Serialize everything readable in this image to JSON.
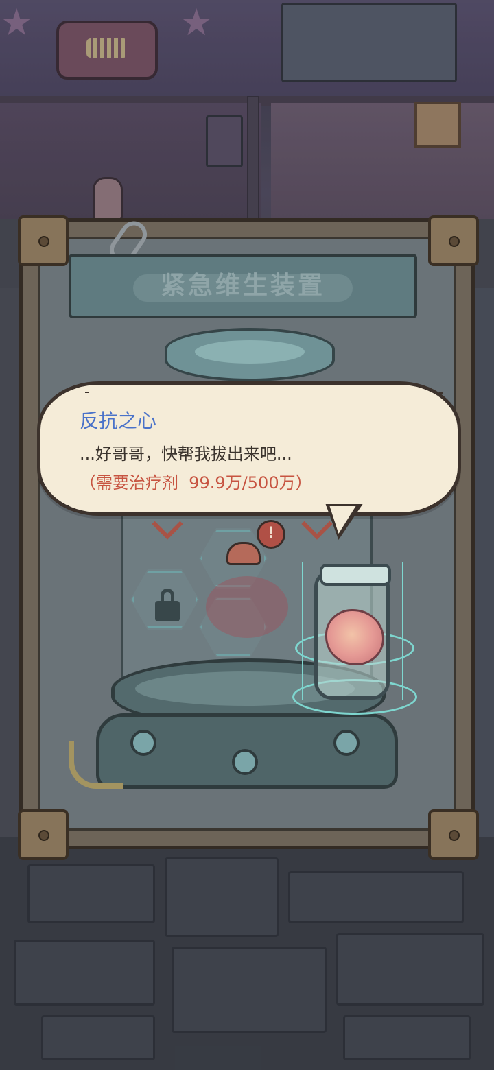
{
  "panel": {
    "title": "紧急维生装置"
  },
  "dialog": {
    "speaker": "反抗之心",
    "line": "...好哥哥，快帮我拔出来吧...",
    "requirement": "（需要治疗剂  99.9万/500万）"
  },
  "machine": {
    "alert_symbol": "!"
  },
  "colors": {
    "speaker": "#4a72c9",
    "requirement": "#c75441",
    "bubble": "#f5ecd8",
    "hologram": "#7ed6cf"
  },
  "icons": [
    "lock-icon",
    "alert-icon",
    "paperclip-icon",
    "brain-jar-icon"
  ]
}
